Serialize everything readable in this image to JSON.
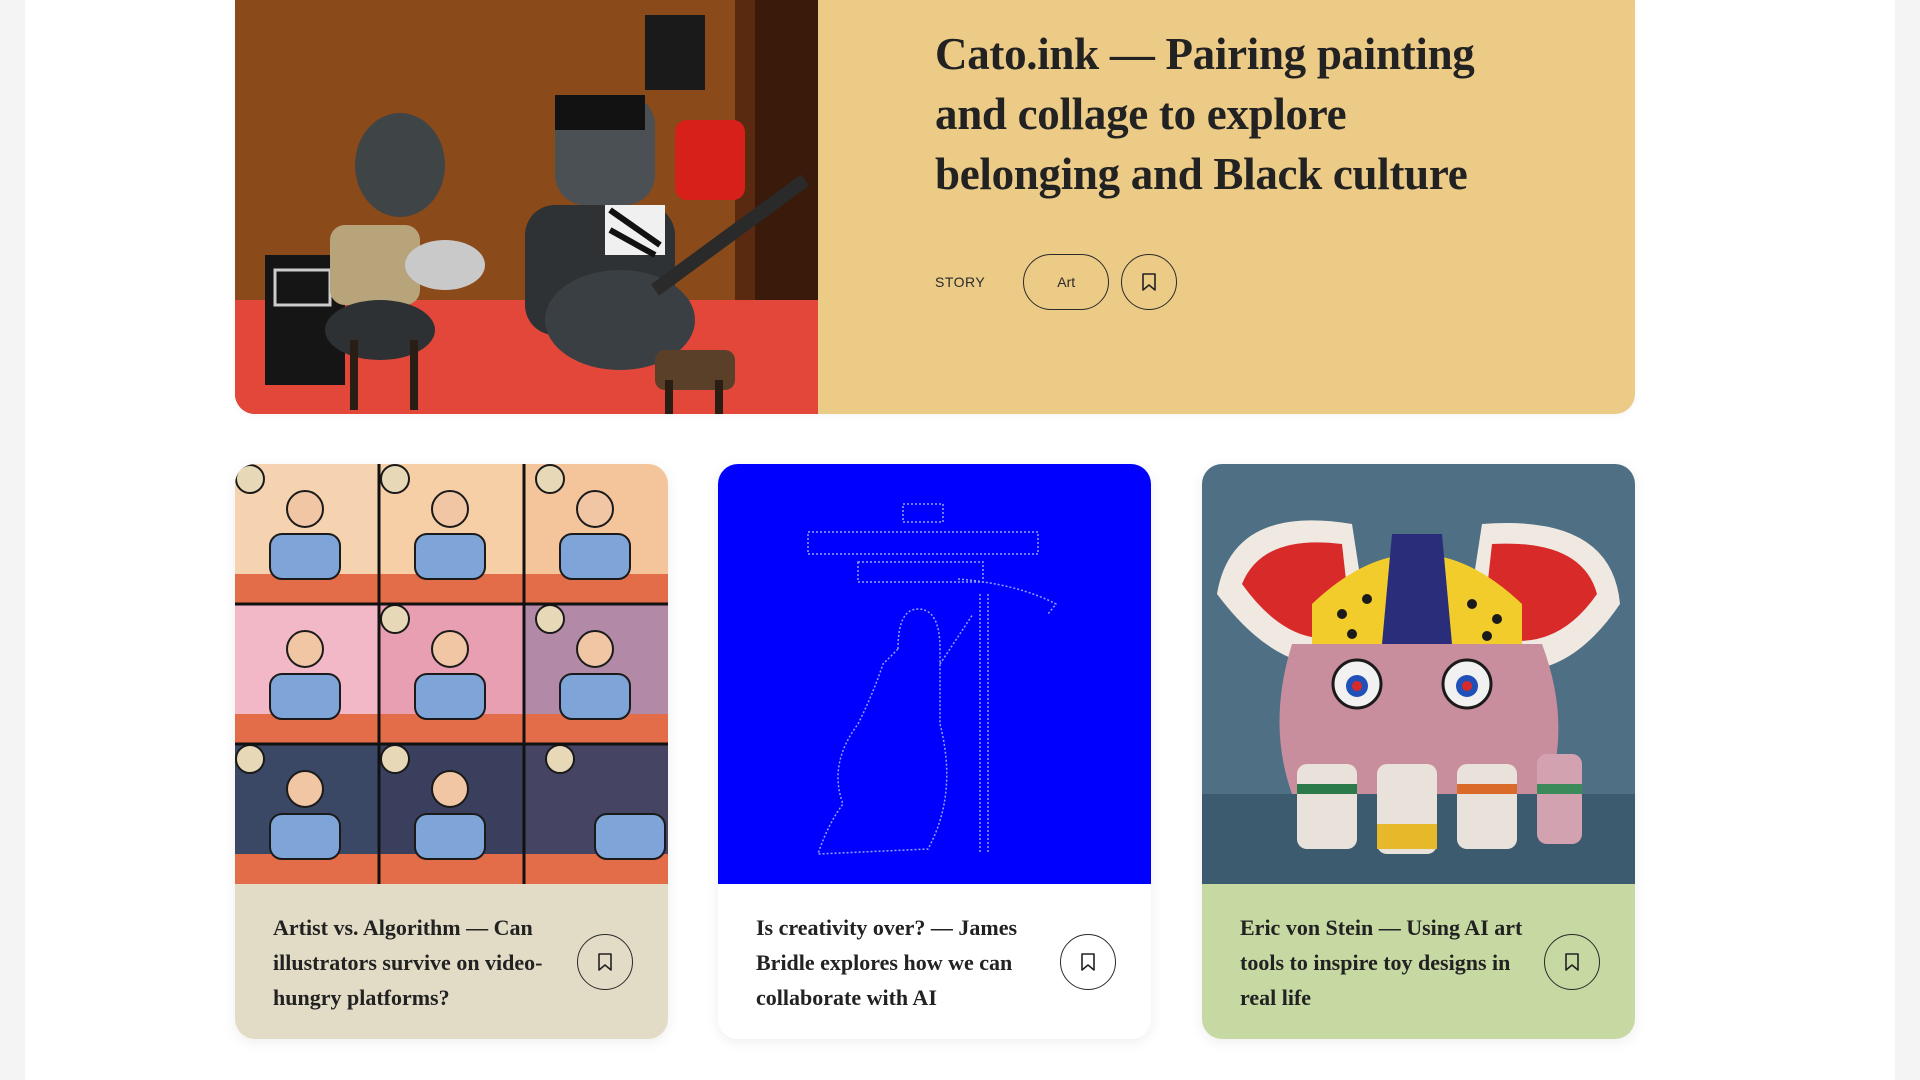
{
  "feature": {
    "title": "Cato.ink — Pairing painting and collage to explore belonging and Black culture",
    "type_label": "STORY",
    "tag": "Art",
    "image_icon": "painting-musicians-image",
    "bookmark_icon": "bookmark-icon"
  },
  "cards": [
    {
      "title": "Artist vs. Algorithm — Can illustrators survive on video-hungry platforms?",
      "image_icon": "comic-grid-illustration",
      "bookmark_icon": "bookmark-icon",
      "color": "#e2dcc6"
    },
    {
      "title": "Is creativity over? — James Bridle explores how we can collaborate with AI",
      "image_icon": "ascii-art-grim-reaper",
      "bookmark_icon": "bookmark-icon",
      "color": "#ffffff"
    },
    {
      "title": "Eric von Stein — Using AI art tools to inspire toy designs in real life",
      "image_icon": "toy-elephant-photo",
      "bookmark_icon": "bookmark-icon",
      "color": "#c6d9a3"
    }
  ],
  "colors": {
    "feature_bg": "#eccb87",
    "ascii_bg": "#0000ff"
  }
}
